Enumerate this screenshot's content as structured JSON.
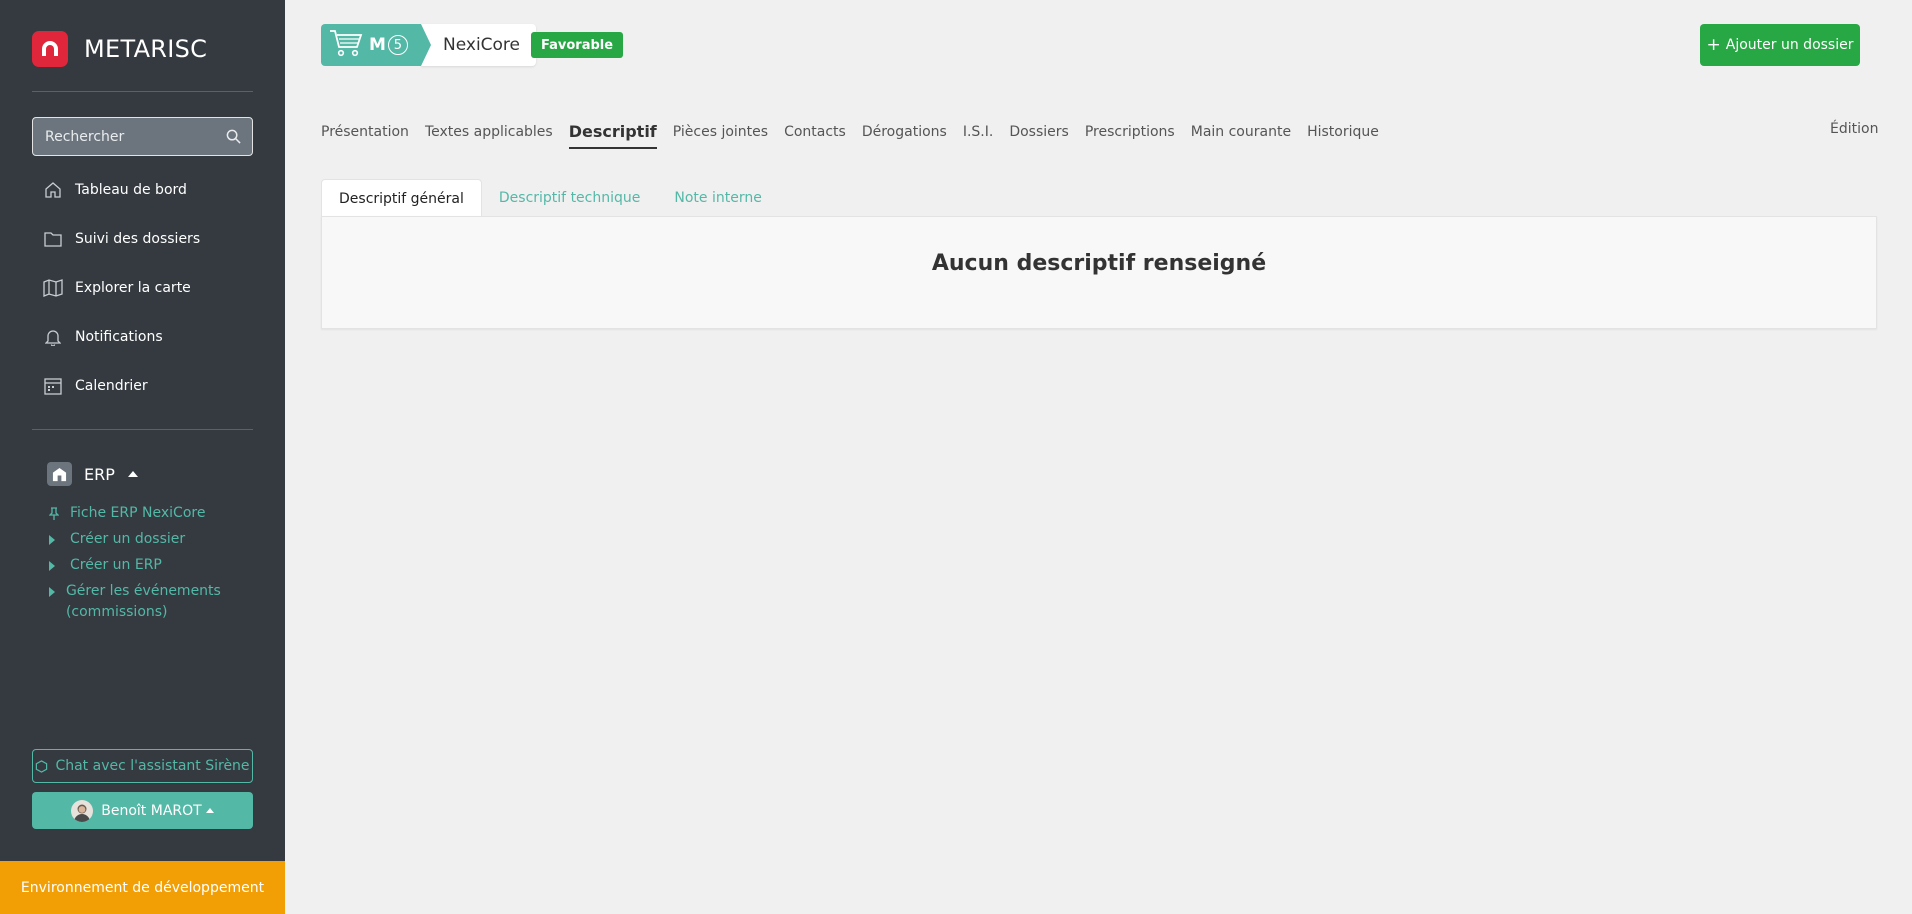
{
  "sidebar": {
    "brand": "METARISC",
    "search": {
      "placeholder": "Rechercher"
    },
    "nav": [
      {
        "label": "Tableau de bord",
        "icon": "home-icon"
      },
      {
        "label": "Suivi des dossiers",
        "icon": "folder-icon"
      },
      {
        "label": "Explorer la carte",
        "icon": "map-icon"
      },
      {
        "label": "Notifications",
        "icon": "bell-icon"
      },
      {
        "label": "Calendrier",
        "icon": "calendar-icon"
      }
    ],
    "erp": {
      "label": "ERP",
      "items": [
        {
          "label": "Fiche ERP NexiCore",
          "icon": "pin-icon"
        },
        {
          "label": "Créer un dossier",
          "icon": "caret-right-icon"
        },
        {
          "label": "Créer un ERP",
          "icon": "caret-right-icon"
        },
        {
          "label": "Gérer les événements (commissions)",
          "icon": "caret-right-icon"
        }
      ]
    },
    "chat_label": "Chat avec l'assistant Sirène",
    "user_name": "Benoît MAROT",
    "environment": "Environnement de développement"
  },
  "header": {
    "category_type": "M",
    "category_number": "5",
    "establishment_name": "NexiCore",
    "status": "Favorable",
    "add_button": "Ajouter un dossier"
  },
  "tabs": [
    {
      "label": "Présentation",
      "active": false
    },
    {
      "label": "Textes applicables",
      "active": false
    },
    {
      "label": "Descriptif",
      "active": true
    },
    {
      "label": "Pièces jointes",
      "active": false
    },
    {
      "label": "Contacts",
      "active": false
    },
    {
      "label": "Dérogations",
      "active": false
    },
    {
      "label": "I.S.I.",
      "active": false
    },
    {
      "label": "Dossiers",
      "active": false
    },
    {
      "label": "Prescriptions",
      "active": false
    },
    {
      "label": "Main courante",
      "active": false
    },
    {
      "label": "Historique",
      "active": false
    }
  ],
  "edition_label": "Édition",
  "subtabs": [
    {
      "label": "Descriptif général",
      "active": true
    },
    {
      "label": "Descriptif technique",
      "active": false
    },
    {
      "label": "Note interne",
      "active": false
    }
  ],
  "panel": {
    "message": "Aucun descriptif renseigné"
  },
  "colors": {
    "sidebar_bg": "#343a40",
    "accent_teal": "#54b8a7",
    "brand_red": "#e0263a",
    "success_green": "#28a745",
    "env_orange": "#f29f05",
    "page_bg": "#f0f0f0"
  }
}
